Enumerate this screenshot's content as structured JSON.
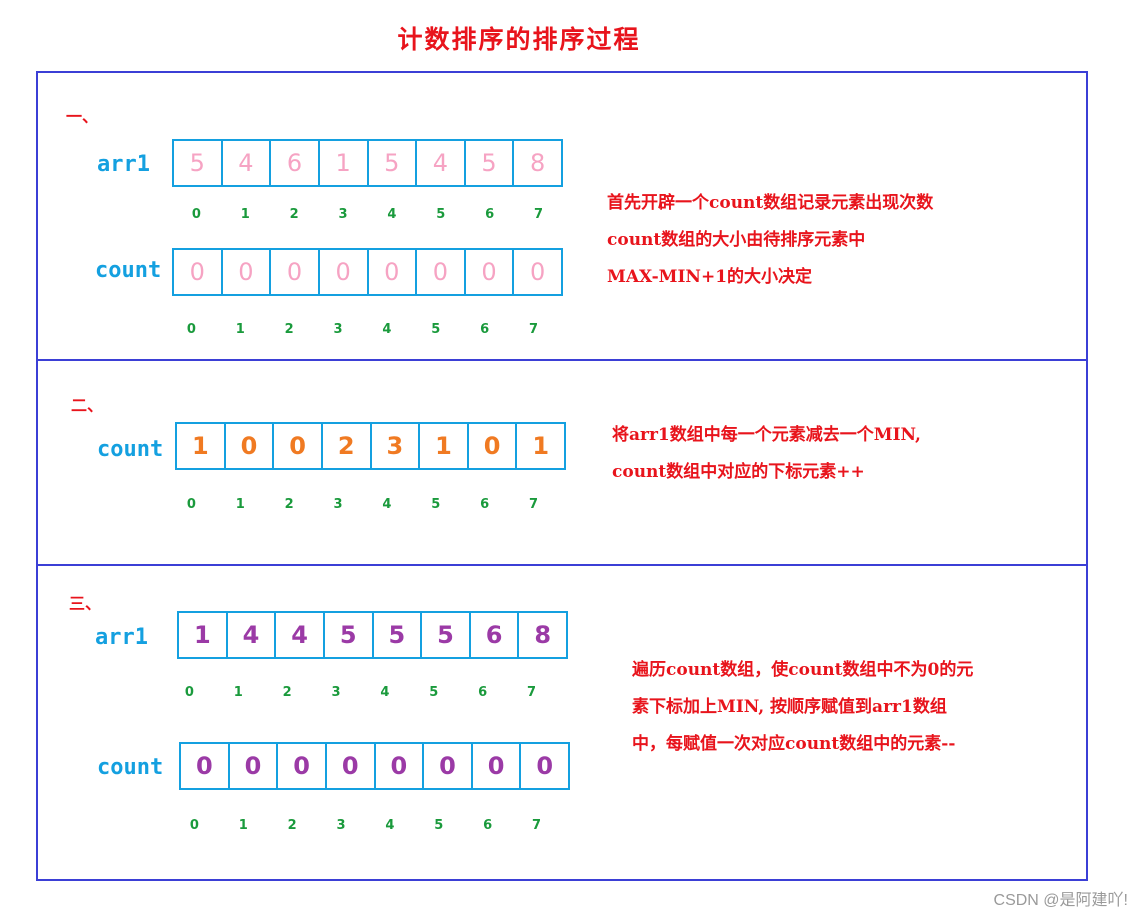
{
  "title": "计数排序的排序过程",
  "sections": [
    {
      "step": "一、",
      "arrays": [
        {
          "label": "arr1",
          "values": [
            "5",
            "4",
            "6",
            "1",
            "5",
            "4",
            "5",
            "8"
          ],
          "indices": [
            "0",
            "1",
            "2",
            "3",
            "4",
            "5",
            "6",
            "7"
          ],
          "color": "#f6a3c3"
        },
        {
          "label": "count",
          "values": [
            "0",
            "0",
            "0",
            "0",
            "0",
            "0",
            "0",
            "0"
          ],
          "indices": [
            "0",
            "1",
            "2",
            "3",
            "4",
            "5",
            "6",
            "7"
          ],
          "color": "#f6a3c3"
        }
      ],
      "note": [
        "首先开辟一个count数组记录元素出现次数",
        "count数组的大小由待排序元素中",
        "MAX-MIN+1的大小决定"
      ]
    },
    {
      "step": "二、",
      "arrays": [
        {
          "label": "count",
          "values": [
            "1",
            "0",
            "0",
            "2",
            "3",
            "1",
            "0",
            "1"
          ],
          "indices": [
            "0",
            "1",
            "2",
            "3",
            "4",
            "5",
            "6",
            "7"
          ],
          "color": "#f07a22"
        }
      ],
      "note": [
        "将arr1数组中每一个元素减去一个MIN,",
        "count数组中对应的下标元素++"
      ]
    },
    {
      "step": "三、",
      "arrays": [
        {
          "label": "arr1",
          "values": [
            "1",
            "4",
            "4",
            "5",
            "5",
            "5",
            "6",
            "8"
          ],
          "indices": [
            "0",
            "1",
            "2",
            "3",
            "4",
            "5",
            "6",
            "7"
          ],
          "color": "#9b3aa6"
        },
        {
          "label": "count",
          "values": [
            "0",
            "0",
            "0",
            "0",
            "0",
            "0",
            "0",
            "0"
          ],
          "indices": [
            "0",
            "1",
            "2",
            "3",
            "4",
            "5",
            "6",
            "7"
          ],
          "color": "#9b3aa6"
        }
      ],
      "note": [
        "遍历count数组，使count数组中不为0的元",
        "素下标加上MIN, 按顺序赋值到arr1数组",
        "中，每赋值一次对应count数组中的元素--"
      ]
    }
  ],
  "colors": {
    "frame": "#3b3fd6",
    "array_border": "#14a0e0",
    "label": "#14a0e0",
    "index": "#1a9a3c",
    "note": "#e8141c"
  },
  "watermark": "CSDN @是阿建吖!"
}
